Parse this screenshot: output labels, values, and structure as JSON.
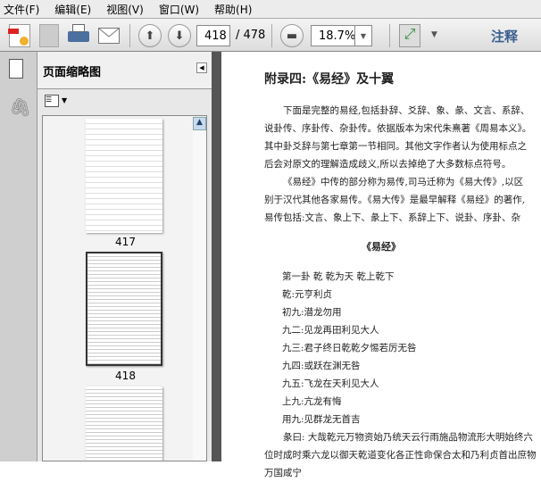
{
  "menu": [
    "文件(F)",
    "编辑(E)",
    "视图(V)",
    "窗口(W)",
    "帮助(H)"
  ],
  "toolbar": {
    "page_current": "418",
    "page_total": "/ 478",
    "zoom": "18.7%",
    "comment": "注释"
  },
  "panel": {
    "title": "页面缩略图",
    "thumbnails": [
      "417",
      "418"
    ]
  },
  "doc": {
    "title": "附录四:《易经》及十翼",
    "para1": "下面是完整的易经,包括卦辞、爻辞、象、彖、文言、系辞、说卦传、序卦传、杂卦传。依据版本为宋代朱熹著《周易本义》。其中卦爻辞与第七章第一节相同。其他文字作者认为使用标点之后会对原文的理解造成歧义,所以去掉绝了大多数标点符号。",
    "para2": "《易经》中传的部分称为易传,司马迁称为《易大传》,以区别于汉代其他各家易传。《易大传》是最早解释《易经》的著作,易传包括:文言、象上下、彖上下、系辞上下、说卦、序卦、杂卦。翼者羽翼,辅助之意,表明十翼旨在解释阐述《易经》。",
    "subtitle": "《易经》",
    "lines": [
      "第一卦 乾 乾为天 乾上乾下",
      "乾:元亨利贞",
      "初九:潜龙勿用",
      "九二:见龙再田利见大人",
      "九三:君子终日乾乾夕惕若厉无咎",
      "九四:或跃在渊无咎",
      "九五:飞龙在天利见大人",
      "上九:亢龙有悔",
      "用九:见群龙无首吉"
    ],
    "para3": "彖曰: 大哉乾元万物资始乃统天云行雨施品物流形大明始终六位时成时乘六龙以御天乾道变化各正性命保合太和乃利贞首出庶物万国咸宁"
  },
  "colors": {
    "accent": "#3a5f8f"
  }
}
